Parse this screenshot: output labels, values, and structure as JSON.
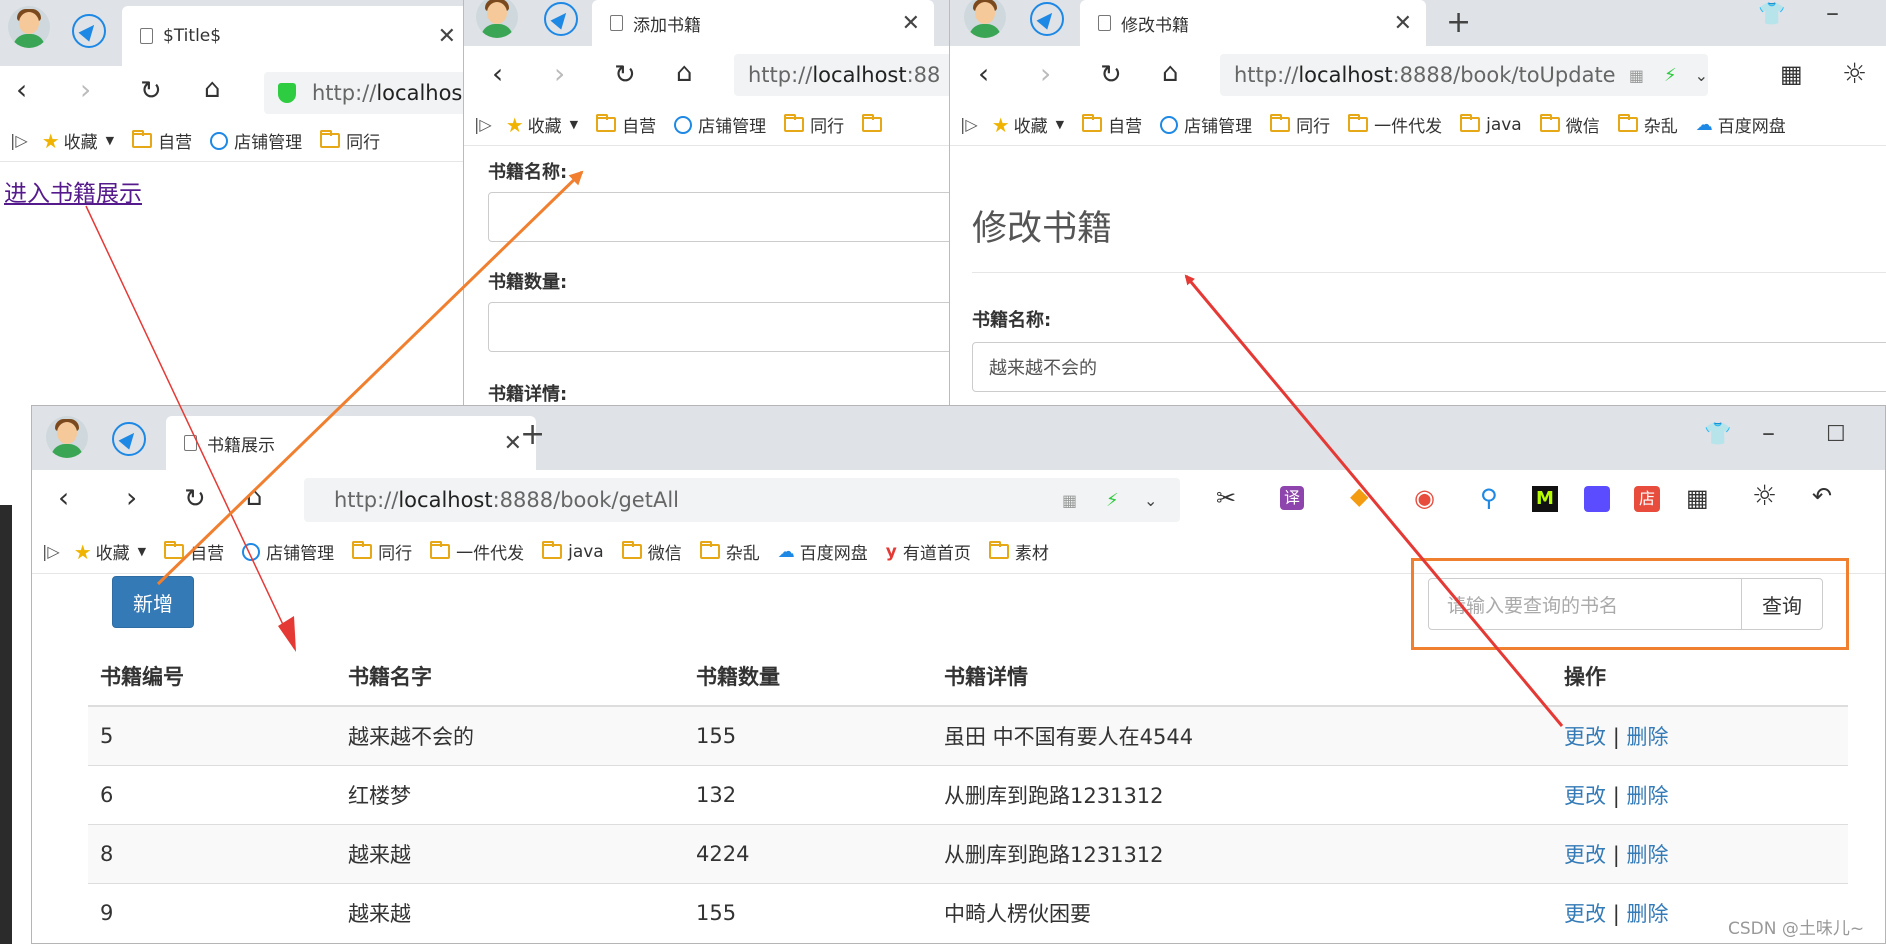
{
  "win1": {
    "tab_title": "$Title$",
    "url_prefix": "http://",
    "url_host": "localhos",
    "link": "进入书籍展示"
  },
  "win2": {
    "tab_title": "添加书籍",
    "url_prefix": "http://",
    "url_host": "localhost",
    "url_rest": ":88",
    "label_name": "书籍名称:",
    "label_count": "书籍数量:",
    "label_detail": "书籍详情:"
  },
  "win3": {
    "tab_title": "修改书籍",
    "url_prefix": "http://",
    "url_host": "localhost",
    "url_rest": ":8888/book/toUpdate",
    "heading": "修改书籍",
    "label_name": "书籍名称:",
    "name_value": "越来越不会的"
  },
  "win4": {
    "tab_title": "书籍展示",
    "url_prefix": "http://",
    "url_host": "localhost",
    "url_rest": ":8888/book/getAll",
    "add_button": "新增",
    "search_placeholder": "请输入要查询的书名",
    "search_button": "查询",
    "columns": [
      "书籍编号",
      "书籍名字",
      "书籍数量",
      "书籍详情",
      "操作"
    ],
    "rows": [
      {
        "id": "5",
        "name": "越来越不会的",
        "count": "155",
        "detail": "虽田 中不国有要人在4544"
      },
      {
        "id": "6",
        "name": "红楼梦",
        "count": "132",
        "detail": "从删库到跑路1231312"
      },
      {
        "id": "8",
        "name": "越来越",
        "count": "4224",
        "detail": "从删库到跑路1231312"
      },
      {
        "id": "9",
        "name": "越来越",
        "count": "155",
        "detail": "中畸人楞伙困要"
      }
    ],
    "action_edit": "更改",
    "action_sep": "|",
    "action_delete": "删除"
  },
  "bookmarks": {
    "favorites": "收藏",
    "items": [
      "自营",
      "店铺管理",
      "同行",
      "一件代发",
      "java",
      "微信",
      "杂乱",
      "百度网盘",
      "有道首页",
      "素材"
    ]
  },
  "watermark": "CSDN @土味儿~",
  "colors": {
    "arrow_red": "#e53935",
    "arrow_orange": "#f08030",
    "highlight_box": "#f08030",
    "primary": "#337ab7"
  }
}
